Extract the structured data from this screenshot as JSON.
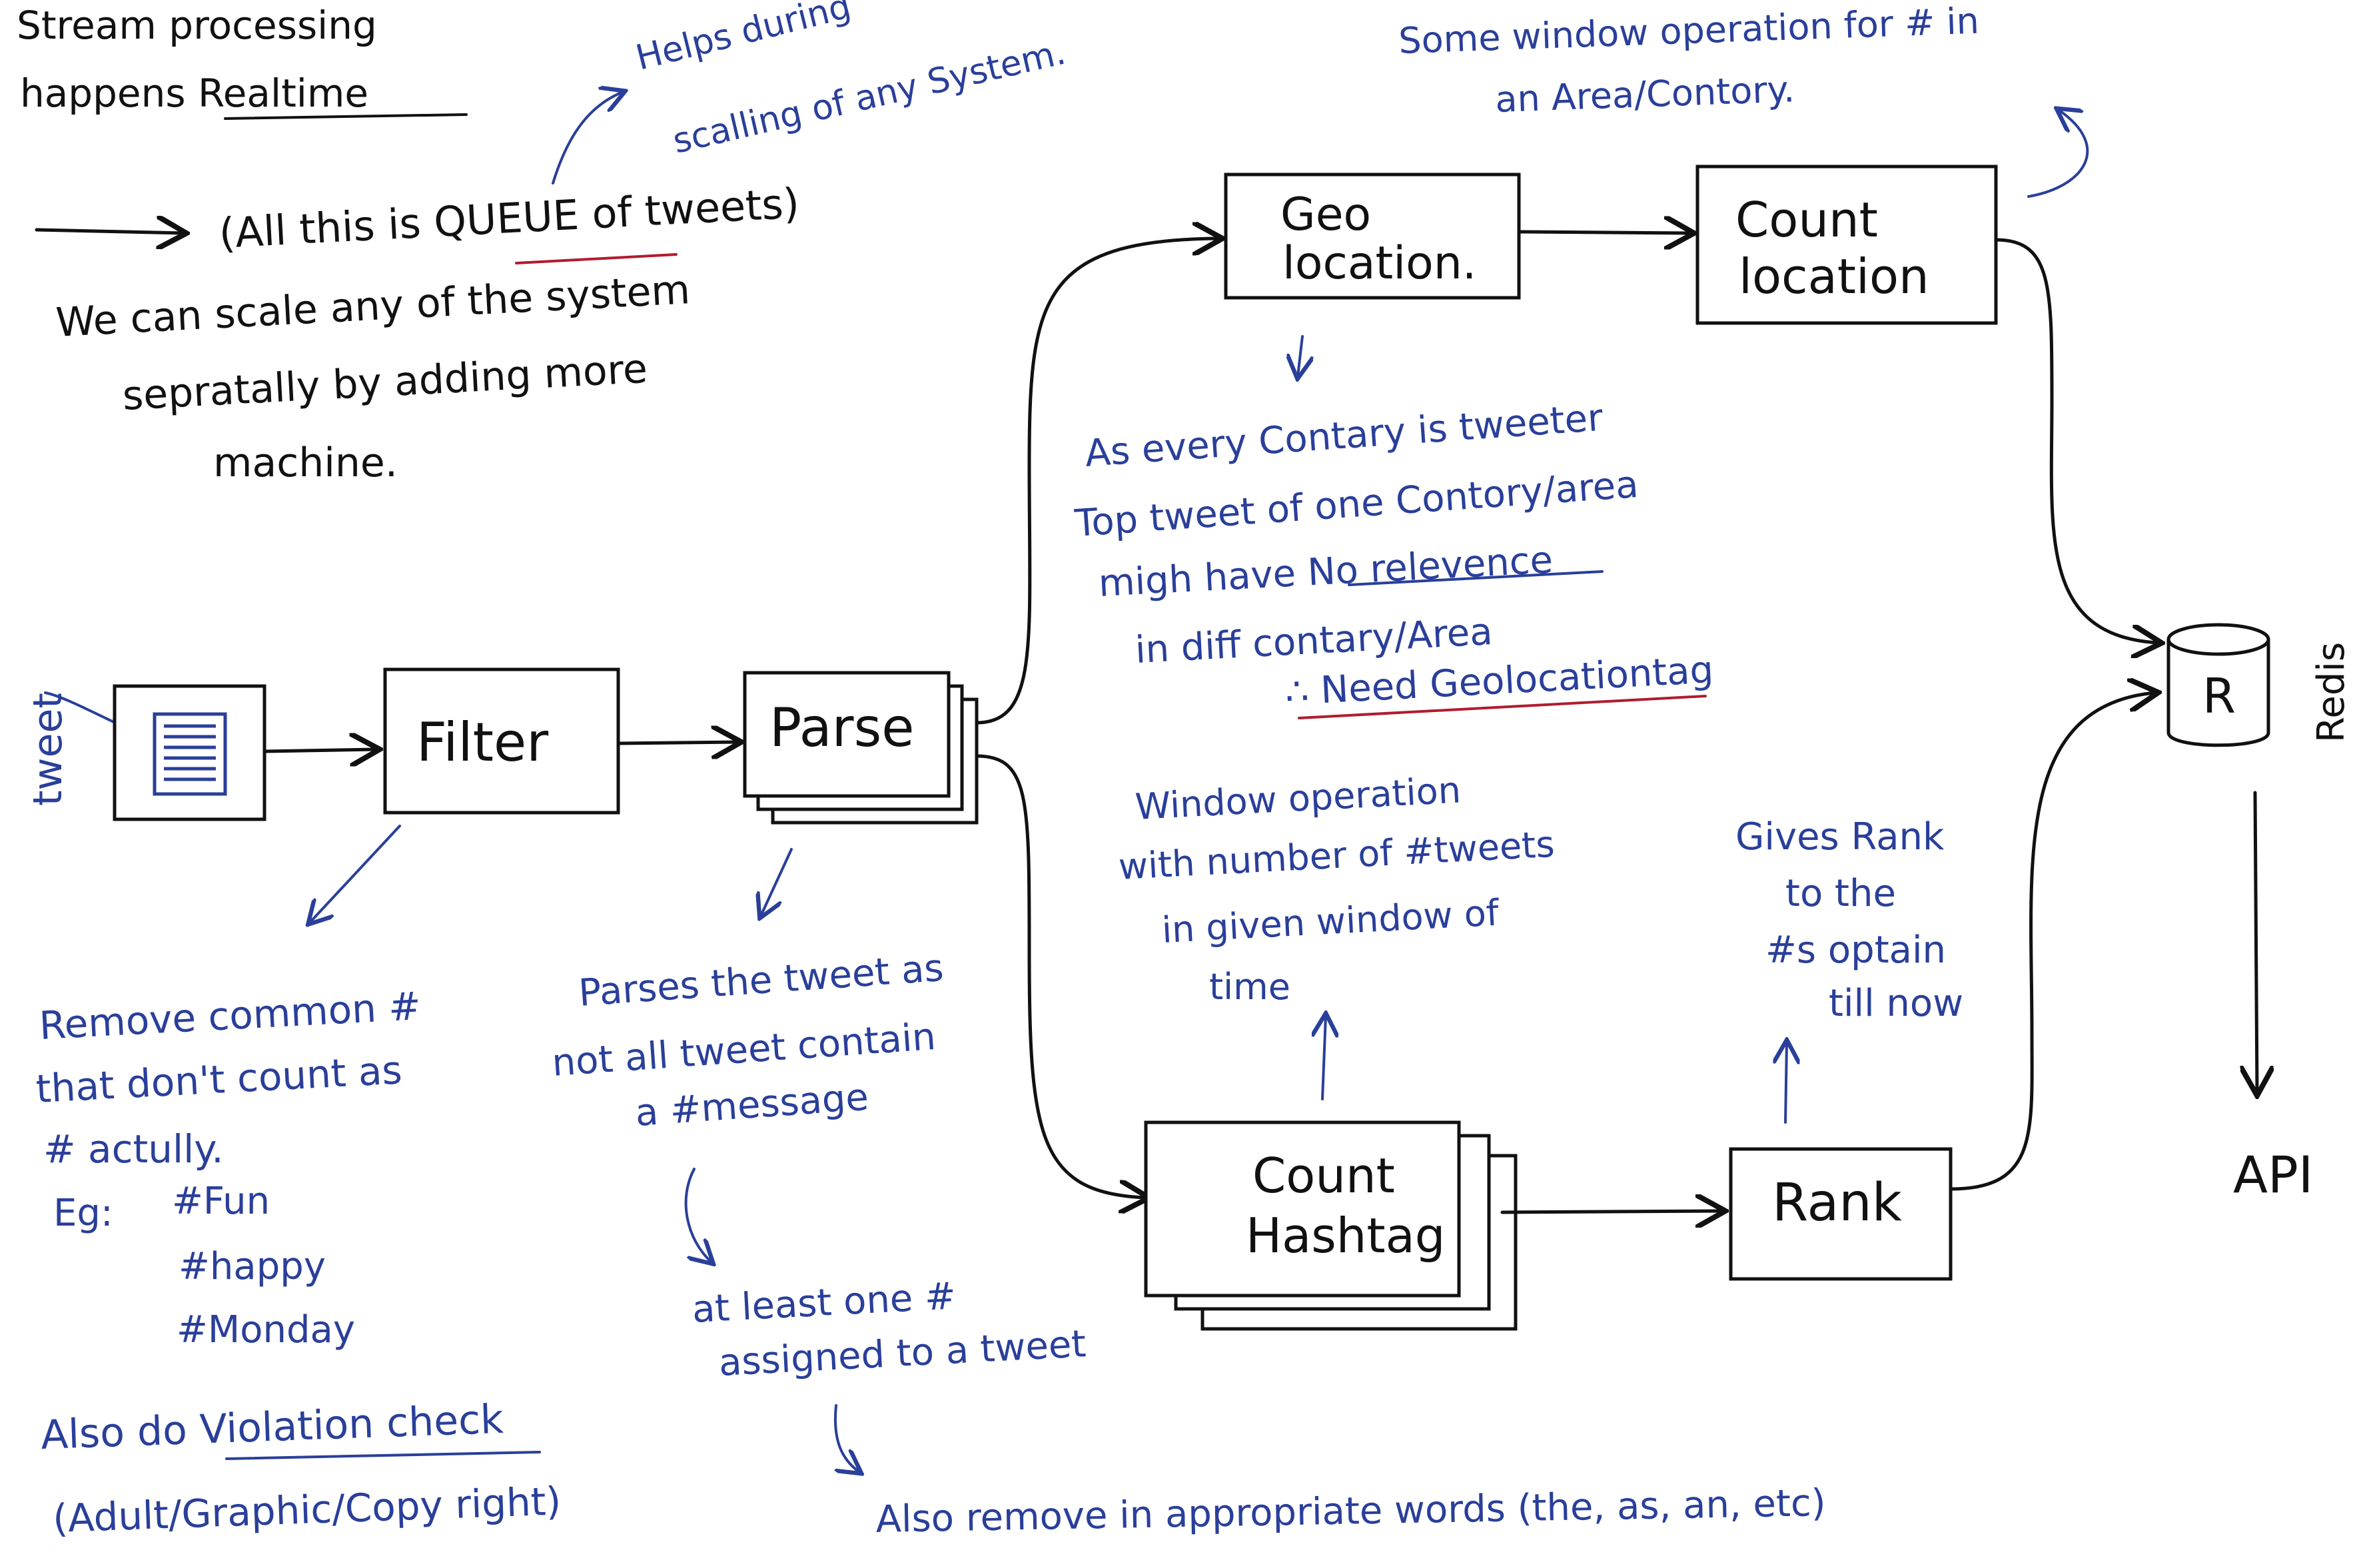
{
  "colors": {
    "black_ink": "#111111",
    "blue_ink": "#2a3f9a",
    "red_ink": "#b01c2e",
    "paper": "#ffffff"
  },
  "notes": {
    "title_line1": "Stream processing",
    "title_line2": "happens Realtime",
    "helps_line1": "Helps during",
    "helps_line2": "scalling of any System.",
    "queue_note": "(All this is QUEUE of tweets)",
    "scale_line1": "We can scale any of the system",
    "scale_line2": "sepratally by adding more",
    "scale_line3": "machine.",
    "window_top_line1": "Some window operation for # in",
    "window_top_line2": "an Area/Contory.",
    "geo_note_line1": "As every Contary is tweeter",
    "geo_note_line2": "Top tweet of one Contory/area",
    "geo_note_line3": "migh have No relevence",
    "geo_note_line4": "in diff contary/Area",
    "geo_note_line5": "∴ Need Geolocationtag",
    "window_mid_line1": "Window operation",
    "window_mid_line2": "with number of #tweets",
    "window_mid_line3": "in given window of",
    "window_mid_line4": "time",
    "rank_note_line1": "Gives Rank",
    "rank_note_line2": "to the",
    "rank_note_line3": "#s optain",
    "rank_note_line4": "till now",
    "filter_note_line1": "Remove common #",
    "filter_note_line2": "that don't count as",
    "filter_note_line3": "# actully.",
    "filter_eg": "Eg:",
    "filter_eg1": "#Fun",
    "filter_eg2": "#happy",
    "filter_eg3": "#Monday",
    "violation_line1": "Also do Violation check",
    "violation_line2": "(Adult/Graphic/Copy right)",
    "parse_note_line1": "Parses the tweet as",
    "parse_note_line2": "not all tweet contain",
    "parse_note_line3": "a #message",
    "least_line1": "at least one #",
    "least_line2": "assigned to a tweet",
    "remove_words": "Also remove in appropriate words (the, as, an, etc)"
  },
  "nodes": {
    "tweet_label": "tweet",
    "filter": "Filter",
    "parse": "Parse",
    "geo_line1": "Geo",
    "geo_line2": "location.",
    "count_loc_line1": "Count",
    "count_loc_line2": "location",
    "count_hash_line1": "Count",
    "count_hash_line2": "Hashtag",
    "rank": "Rank",
    "redis_symbol": "R",
    "redis_label": "Redis",
    "api": "API"
  }
}
